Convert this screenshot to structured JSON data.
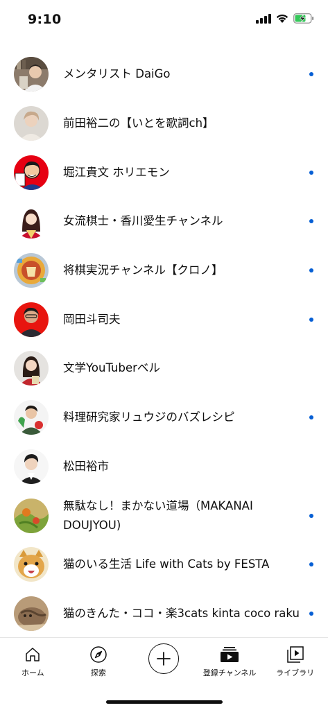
{
  "status_bar": {
    "time": "9:10"
  },
  "colors": {
    "new_dot": "#065fd4",
    "text": "#0f0f0f"
  },
  "channels": [
    {
      "name": "メンタリスト DaiGo",
      "has_new": true,
      "avatar_icon": "daigo-avatar"
    },
    {
      "name": "前田裕二の【いとを歌詞ch】",
      "has_new": false,
      "avatar_icon": "maeda-avatar"
    },
    {
      "name": "堀江貴文 ホリエモン",
      "has_new": true,
      "avatar_icon": "horie-avatar"
    },
    {
      "name": "女流棋士・香川愛生チャンネル",
      "has_new": true,
      "avatar_icon": "kagawa-avatar"
    },
    {
      "name": "将棋実況チャンネル【クロノ】",
      "has_new": true,
      "avatar_icon": "kurono-avatar"
    },
    {
      "name": "岡田斗司夫",
      "has_new": true,
      "avatar_icon": "okada-avatar"
    },
    {
      "name": "文学YouTuberベル",
      "has_new": false,
      "avatar_icon": "belle-avatar"
    },
    {
      "name": "料理研究家リュウジのバズレシピ",
      "has_new": true,
      "avatar_icon": "ryuji-avatar"
    },
    {
      "name": "松田裕市",
      "has_new": false,
      "avatar_icon": "matsuda-avatar"
    },
    {
      "name": "無駄なし！まかない道場（MAKANAI DOUJYOU)",
      "has_new": true,
      "avatar_icon": "makanai-avatar"
    },
    {
      "name": "猫のいる生活 Life with Cats by FESTA",
      "has_new": true,
      "avatar_icon": "cat-avatar"
    },
    {
      "name": "猫のきんた・ココ・楽3cats kinta coco raku",
      "has_new": true,
      "avatar_icon": "kinta-avatar"
    }
  ],
  "bottom_nav": {
    "home": "ホーム",
    "explore": "探索",
    "subscriptions": "登録チャンネル",
    "library": "ライブラリ"
  }
}
